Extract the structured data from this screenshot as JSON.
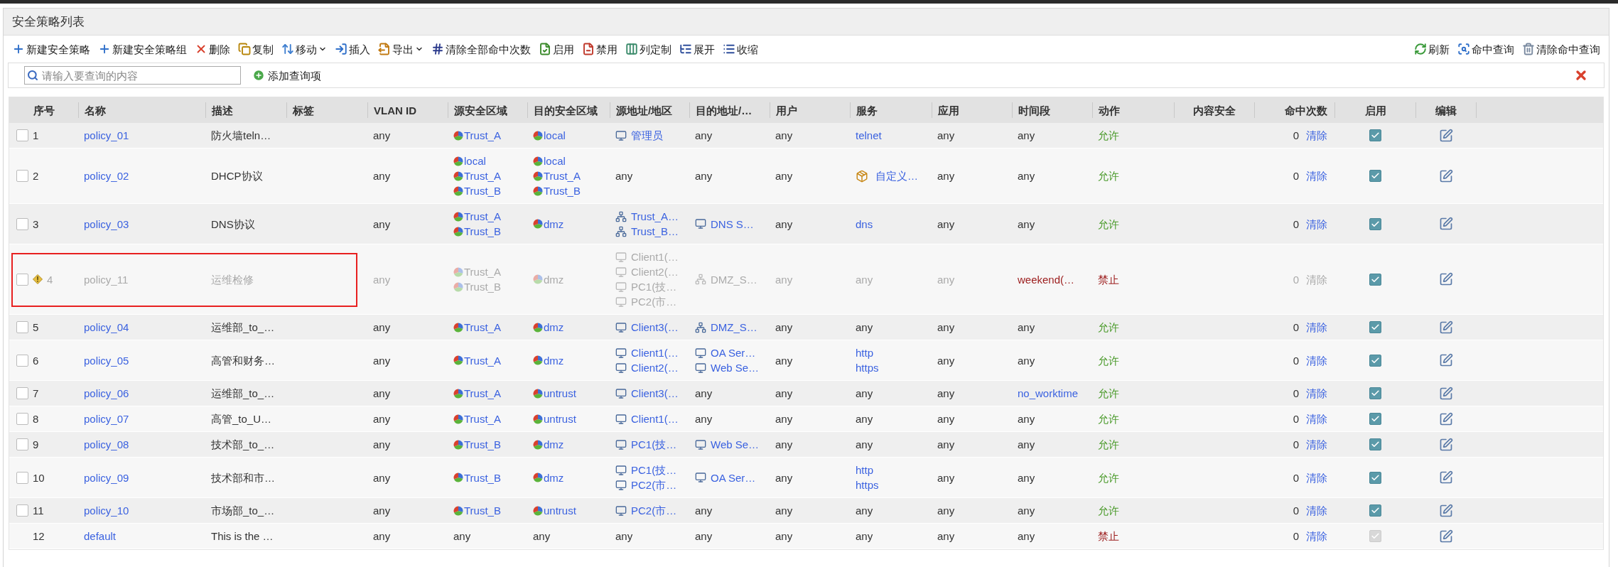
{
  "panel": {
    "title": "安全策略列表"
  },
  "toolbar": {
    "left": [
      {
        "label": "新建安全策略",
        "dropdown": false
      },
      {
        "label": "新建安全策略组",
        "dropdown": false
      },
      {
        "label": "删除",
        "dropdown": false
      },
      {
        "label": "复制",
        "dropdown": false
      },
      {
        "label": "移动",
        "dropdown": true
      },
      {
        "label": "插入",
        "dropdown": false
      },
      {
        "label": "导出",
        "dropdown": true
      },
      {
        "label": "清除全部命中次数",
        "dropdown": false
      },
      {
        "label": "启用",
        "dropdown": false
      },
      {
        "label": "禁用",
        "dropdown": false
      },
      {
        "label": "列定制",
        "dropdown": false
      },
      {
        "label": "展开",
        "dropdown": false
      },
      {
        "label": "收缩",
        "dropdown": false
      }
    ],
    "right": [
      {
        "label": "刷新",
        "dropdown": false
      },
      {
        "label": "命中查询",
        "dropdown": false
      },
      {
        "label": "清除命中查询",
        "dropdown": false
      }
    ]
  },
  "search": {
    "placeholder": "请输入要查询的内容",
    "add_label": "添加查询项"
  },
  "table": {
    "columns": [
      "序号",
      "名称",
      "描述",
      "标签",
      "VLAN ID",
      "源安全区域",
      "目的安全区域",
      "源地址/地区",
      "目的地址/…",
      "用户",
      "服务",
      "应用",
      "时间段",
      "动作",
      "内容安全",
      "命中次数",
      "启用",
      "编辑"
    ],
    "rows": [
      {
        "kind": "policy",
        "selected": false,
        "warning": false,
        "inactive": false,
        "flagged": false,
        "number": "1",
        "name": "policy_01",
        "description": "防火墙teln…",
        "vlan": "any",
        "src_zone": [
          {
            "text": "Trust_A",
            "kind": "zone"
          }
        ],
        "dst_zone": [
          {
            "text": "local",
            "kind": "zone"
          }
        ],
        "src_addr": [
          {
            "text": "管理员",
            "kind": "host"
          }
        ],
        "dst_addr": [
          {
            "text": "any",
            "kind": "plain"
          }
        ],
        "user": [
          {
            "text": "any",
            "kind": "plain"
          }
        ],
        "service": [
          {
            "text": "telnet",
            "kind": "link"
          }
        ],
        "app": [
          {
            "text": "any",
            "kind": "plain"
          }
        ],
        "schedule": [
          {
            "text": "any",
            "kind": "plain"
          }
        ],
        "action": {
          "text": "允许",
          "kind": "allow"
        },
        "hits": "0",
        "clear": "清除",
        "enabled": true
      },
      {
        "kind": "policy",
        "selected": false,
        "warning": false,
        "inactive": false,
        "flagged": false,
        "number": "2",
        "name": "policy_02",
        "description": "DHCP协议",
        "vlan": "any",
        "src_zone": [
          {
            "text": "local",
            "kind": "zone"
          },
          {
            "text": "Trust_A",
            "kind": "zone"
          },
          {
            "text": "Trust_B",
            "kind": "zone"
          }
        ],
        "dst_zone": [
          {
            "text": "local",
            "kind": "zone"
          },
          {
            "text": "Trust_A",
            "kind": "zone"
          },
          {
            "text": "Trust_B",
            "kind": "zone"
          }
        ],
        "src_addr": [
          {
            "text": "any",
            "kind": "plain"
          }
        ],
        "dst_addr": [
          {
            "text": "any",
            "kind": "plain"
          }
        ],
        "user": [
          {
            "text": "any",
            "kind": "plain"
          }
        ],
        "service": [
          {
            "text": "自定义…",
            "kind": "custom"
          }
        ],
        "app": [
          {
            "text": "any",
            "kind": "plain"
          }
        ],
        "schedule": [
          {
            "text": "any",
            "kind": "plain"
          }
        ],
        "action": {
          "text": "允许",
          "kind": "allow"
        },
        "hits": "0",
        "clear": "清除",
        "enabled": true
      },
      {
        "kind": "policy",
        "selected": false,
        "warning": false,
        "inactive": false,
        "flagged": false,
        "number": "3",
        "name": "policy_03",
        "description": "DNS协议",
        "vlan": "any",
        "src_zone": [
          {
            "text": "Trust_A",
            "kind": "zone"
          },
          {
            "text": "Trust_B",
            "kind": "zone"
          }
        ],
        "dst_zone": [
          {
            "text": "dmz",
            "kind": "zone"
          }
        ],
        "src_addr": [
          {
            "text": "Trust_A…",
            "kind": "network"
          },
          {
            "text": "Trust_B…",
            "kind": "network"
          }
        ],
        "dst_addr": [
          {
            "text": "DNS S…",
            "kind": "host"
          }
        ],
        "user": [
          {
            "text": "any",
            "kind": "plain"
          }
        ],
        "service": [
          {
            "text": "dns",
            "kind": "link"
          }
        ],
        "app": [
          {
            "text": "any",
            "kind": "plain"
          }
        ],
        "schedule": [
          {
            "text": "any",
            "kind": "plain"
          }
        ],
        "action": {
          "text": "允许",
          "kind": "allow"
        },
        "hits": "0",
        "clear": "清除",
        "enabled": true
      },
      {
        "kind": "policy",
        "selected": false,
        "warning": true,
        "inactive": true,
        "flagged": true,
        "number": "4",
        "name": "policy_11",
        "description": "运维检修",
        "vlan": "any",
        "src_zone": [
          {
            "text": "Trust_A",
            "kind": "zone"
          },
          {
            "text": "Trust_B",
            "kind": "zone"
          }
        ],
        "dst_zone": [
          {
            "text": "dmz",
            "kind": "zone"
          }
        ],
        "src_addr": [
          {
            "text": "Client1(…",
            "kind": "host"
          },
          {
            "text": "Client2(…",
            "kind": "host"
          },
          {
            "text": "PC1(技…",
            "kind": "host"
          },
          {
            "text": "PC2(市…",
            "kind": "host"
          }
        ],
        "dst_addr": [
          {
            "text": "DMZ_S…",
            "kind": "network"
          }
        ],
        "user": [
          {
            "text": "any",
            "kind": "plain"
          }
        ],
        "service": [
          {
            "text": "any",
            "kind": "plain"
          }
        ],
        "app": [
          {
            "text": "any",
            "kind": "plain"
          }
        ],
        "schedule": [
          {
            "text": "weekend(…",
            "kind": "alert"
          }
        ],
        "action": {
          "text": "禁止",
          "kind": "deny"
        },
        "hits": "0",
        "clear": "清除",
        "enabled": true
      },
      {
        "kind": "policy",
        "selected": false,
        "warning": false,
        "inactive": false,
        "flagged": false,
        "number": "5",
        "name": "policy_04",
        "description": "运维部_to_…",
        "vlan": "any",
        "src_zone": [
          {
            "text": "Trust_A",
            "kind": "zone"
          }
        ],
        "dst_zone": [
          {
            "text": "dmz",
            "kind": "zone"
          }
        ],
        "src_addr": [
          {
            "text": "Client3(…",
            "kind": "host"
          }
        ],
        "dst_addr": [
          {
            "text": "DMZ_S…",
            "kind": "network"
          }
        ],
        "user": [
          {
            "text": "any",
            "kind": "plain"
          }
        ],
        "service": [
          {
            "text": "any",
            "kind": "plain"
          }
        ],
        "app": [
          {
            "text": "any",
            "kind": "plain"
          }
        ],
        "schedule": [
          {
            "text": "any",
            "kind": "plain"
          }
        ],
        "action": {
          "text": "允许",
          "kind": "allow"
        },
        "hits": "0",
        "clear": "清除",
        "enabled": true
      },
      {
        "kind": "policy",
        "selected": false,
        "warning": false,
        "inactive": false,
        "flagged": false,
        "number": "6",
        "name": "policy_05",
        "description": "高管和财务…",
        "vlan": "any",
        "src_zone": [
          {
            "text": "Trust_A",
            "kind": "zone"
          }
        ],
        "dst_zone": [
          {
            "text": "dmz",
            "kind": "zone"
          }
        ],
        "src_addr": [
          {
            "text": "Client1(…",
            "kind": "host"
          },
          {
            "text": "Client2(…",
            "kind": "host"
          }
        ],
        "dst_addr": [
          {
            "text": "OA Ser…",
            "kind": "host"
          },
          {
            "text": "Web Se…",
            "kind": "host"
          }
        ],
        "user": [
          {
            "text": "any",
            "kind": "plain"
          }
        ],
        "service": [
          {
            "text": "http",
            "kind": "link"
          },
          {
            "text": "https",
            "kind": "link"
          }
        ],
        "app": [
          {
            "text": "any",
            "kind": "plain"
          }
        ],
        "schedule": [
          {
            "text": "any",
            "kind": "plain"
          }
        ],
        "action": {
          "text": "允许",
          "kind": "allow"
        },
        "hits": "0",
        "clear": "清除",
        "enabled": true
      },
      {
        "kind": "policy",
        "selected": false,
        "warning": false,
        "inactive": false,
        "flagged": false,
        "number": "7",
        "name": "policy_06",
        "description": "运维部_to_…",
        "vlan": "any",
        "src_zone": [
          {
            "text": "Trust_A",
            "kind": "zone"
          }
        ],
        "dst_zone": [
          {
            "text": "untrust",
            "kind": "zone"
          }
        ],
        "src_addr": [
          {
            "text": "Client3(…",
            "kind": "host"
          }
        ],
        "dst_addr": [
          {
            "text": "any",
            "kind": "plain"
          }
        ],
        "user": [
          {
            "text": "any",
            "kind": "plain"
          }
        ],
        "service": [
          {
            "text": "any",
            "kind": "plain"
          }
        ],
        "app": [
          {
            "text": "any",
            "kind": "plain"
          }
        ],
        "schedule": [
          {
            "text": "no_worktime",
            "kind": "link"
          }
        ],
        "action": {
          "text": "允许",
          "kind": "allow"
        },
        "hits": "0",
        "clear": "清除",
        "enabled": true
      },
      {
        "kind": "policy",
        "selected": false,
        "warning": false,
        "inactive": false,
        "flagged": false,
        "number": "8",
        "name": "policy_07",
        "description": "高管_to_U…",
        "vlan": "any",
        "src_zone": [
          {
            "text": "Trust_A",
            "kind": "zone"
          }
        ],
        "dst_zone": [
          {
            "text": "untrust",
            "kind": "zone"
          }
        ],
        "src_addr": [
          {
            "text": "Client1(…",
            "kind": "host"
          }
        ],
        "dst_addr": [
          {
            "text": "any",
            "kind": "plain"
          }
        ],
        "user": [
          {
            "text": "any",
            "kind": "plain"
          }
        ],
        "service": [
          {
            "text": "any",
            "kind": "plain"
          }
        ],
        "app": [
          {
            "text": "any",
            "kind": "plain"
          }
        ],
        "schedule": [
          {
            "text": "any",
            "kind": "plain"
          }
        ],
        "action": {
          "text": "允许",
          "kind": "allow"
        },
        "hits": "0",
        "clear": "清除",
        "enabled": true
      },
      {
        "kind": "policy",
        "selected": false,
        "warning": false,
        "inactive": false,
        "flagged": false,
        "number": "9",
        "name": "policy_08",
        "description": "技术部_to_…",
        "vlan": "any",
        "src_zone": [
          {
            "text": "Trust_B",
            "kind": "zone"
          }
        ],
        "dst_zone": [
          {
            "text": "dmz",
            "kind": "zone"
          }
        ],
        "src_addr": [
          {
            "text": "PC1(技…",
            "kind": "host"
          }
        ],
        "dst_addr": [
          {
            "text": "Web Se…",
            "kind": "host"
          }
        ],
        "user": [
          {
            "text": "any",
            "kind": "plain"
          }
        ],
        "service": [
          {
            "text": "any",
            "kind": "plain"
          }
        ],
        "app": [
          {
            "text": "any",
            "kind": "plain"
          }
        ],
        "schedule": [
          {
            "text": "any",
            "kind": "plain"
          }
        ],
        "action": {
          "text": "允许",
          "kind": "allow"
        },
        "hits": "0",
        "clear": "清除",
        "enabled": true
      },
      {
        "kind": "policy",
        "selected": false,
        "warning": false,
        "inactive": false,
        "flagged": false,
        "number": "10",
        "name": "policy_09",
        "description": "技术部和市…",
        "vlan": "any",
        "src_zone": [
          {
            "text": "Trust_B",
            "kind": "zone"
          }
        ],
        "dst_zone": [
          {
            "text": "dmz",
            "kind": "zone"
          }
        ],
        "src_addr": [
          {
            "text": "PC1(技…",
            "kind": "host"
          },
          {
            "text": "PC2(市…",
            "kind": "host"
          }
        ],
        "dst_addr": [
          {
            "text": "OA Ser…",
            "kind": "host"
          }
        ],
        "user": [
          {
            "text": "any",
            "kind": "plain"
          }
        ],
        "service": [
          {
            "text": "http",
            "kind": "link"
          },
          {
            "text": "https",
            "kind": "link"
          }
        ],
        "app": [
          {
            "text": "any",
            "kind": "plain"
          }
        ],
        "schedule": [
          {
            "text": "any",
            "kind": "plain"
          }
        ],
        "action": {
          "text": "允许",
          "kind": "allow"
        },
        "hits": "0",
        "clear": "清除",
        "enabled": true
      },
      {
        "kind": "policy",
        "selected": false,
        "warning": false,
        "inactive": false,
        "flagged": false,
        "number": "11",
        "name": "policy_10",
        "description": "市场部_to_…",
        "vlan": "any",
        "src_zone": [
          {
            "text": "Trust_B",
            "kind": "zone"
          }
        ],
        "dst_zone": [
          {
            "text": "untrust",
            "kind": "zone"
          }
        ],
        "src_addr": [
          {
            "text": "PC2(市…",
            "kind": "host"
          }
        ],
        "dst_addr": [
          {
            "text": "any",
            "kind": "plain"
          }
        ],
        "user": [
          {
            "text": "any",
            "kind": "plain"
          }
        ],
        "service": [
          {
            "text": "any",
            "kind": "plain"
          }
        ],
        "app": [
          {
            "text": "any",
            "kind": "plain"
          }
        ],
        "schedule": [
          {
            "text": "any",
            "kind": "plain"
          }
        ],
        "action": {
          "text": "允许",
          "kind": "allow"
        },
        "hits": "0",
        "clear": "清除",
        "enabled": true
      },
      {
        "kind": "default",
        "selected": false,
        "warning": false,
        "inactive": false,
        "flagged": false,
        "number": "12",
        "name": "default",
        "description": "This is the …",
        "vlan": "any",
        "src_zone": [
          {
            "text": "any",
            "kind": "plain"
          }
        ],
        "dst_zone": [
          {
            "text": "any",
            "kind": "plain"
          }
        ],
        "src_addr": [
          {
            "text": "any",
            "kind": "plain"
          }
        ],
        "dst_addr": [
          {
            "text": "any",
            "kind": "plain"
          }
        ],
        "user": [
          {
            "text": "any",
            "kind": "plain"
          }
        ],
        "service": [
          {
            "text": "any",
            "kind": "plain"
          }
        ],
        "app": [
          {
            "text": "any",
            "kind": "plain"
          }
        ],
        "schedule": [
          {
            "text": "any",
            "kind": "plain"
          }
        ],
        "action": {
          "text": "禁止",
          "kind": "deny"
        },
        "hits": "0",
        "clear": "清除",
        "enabled": true
      }
    ]
  }
}
